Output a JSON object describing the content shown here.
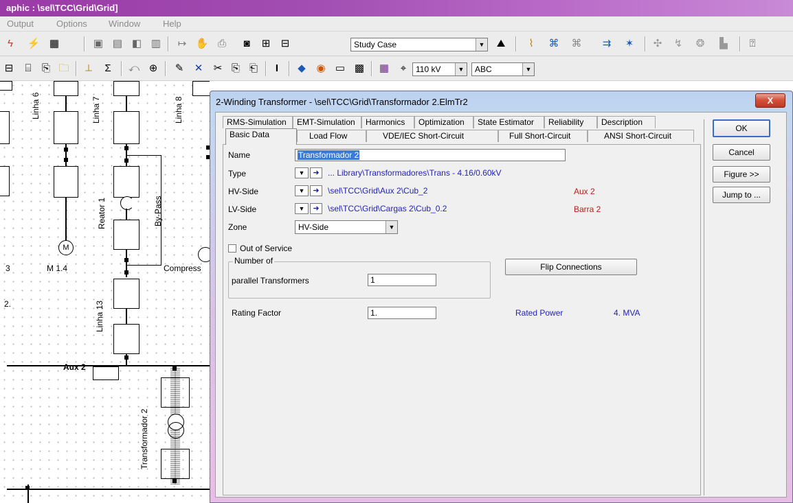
{
  "app": {
    "title": "aphic : \\sel\\TCC\\Grid\\Grid]"
  },
  "menu": {
    "items": [
      "Output",
      "Options",
      "Window",
      "Help"
    ]
  },
  "toolbar": {
    "study_case": "Study Case",
    "voltage": "110 kV",
    "phase": "ABC"
  },
  "canvas": {
    "labels": {
      "linha6": "Linha 6",
      "linha7": "Linha 7",
      "linha8": "Linha 8",
      "reator1": "Reator 1",
      "bypass": "By-Pass",
      "motor_symbol": "M",
      "motor_label": "M 1.4",
      "compress": "Compress",
      "linha13": "Linha 13",
      "aux2": "Aux 2",
      "transformador2": "Transformador 2",
      "left_3": "3",
      "left_2": "2."
    }
  },
  "dialog": {
    "title": "2-Winding Transformer - \\sel\\TCC\\Grid\\Transformador 2.ElmTr2",
    "close": "X",
    "tabs_row1": [
      "RMS-Simulation",
      "EMT-Simulation",
      "Harmonics",
      "Optimization",
      "State Estimator",
      "Reliability",
      "Description"
    ],
    "tabs_row2": [
      "Basic Data",
      "Load Flow",
      "VDE/IEC Short-Circuit",
      "Full Short-Circuit",
      "ANSI Short-Circuit"
    ],
    "buttons": {
      "ok": "OK",
      "cancel": "Cancel",
      "figure": "Figure >>",
      "jump_to": "Jump to ..."
    },
    "fields": {
      "name_label": "Name",
      "name_value": "Transformador 2",
      "type_label": "Type",
      "type_value": "... Library\\Transformadores\\Trans - 4.16/0.60kV",
      "hv_label": "HV-Side",
      "hv_value": "\\sel\\TCC\\Grid\\Aux 2\\Cub_2",
      "hv_bus": "Aux 2",
      "lv_label": "LV-Side",
      "lv_value": "\\sel\\TCC\\Grid\\Cargas 2\\Cub_0.2",
      "lv_bus": "Barra 2",
      "zone_label": "Zone",
      "zone_value": "HV-Side",
      "out_of_service": "Out of Service",
      "number_of": "Number of",
      "parallel_label": "parallel Transformers",
      "parallel_value": "1",
      "flip_button": "Flip Connections",
      "rating_factor_label": "Rating Factor",
      "rating_factor_value": "1.",
      "rated_power_label": "Rated Power",
      "rated_power_value": "4. MVA"
    }
  },
  "colors": {
    "title_bar": "#a24eb2",
    "link_blue": "#2323b5",
    "bus_red": "#b0221b",
    "selection": "#3a7bd5"
  }
}
